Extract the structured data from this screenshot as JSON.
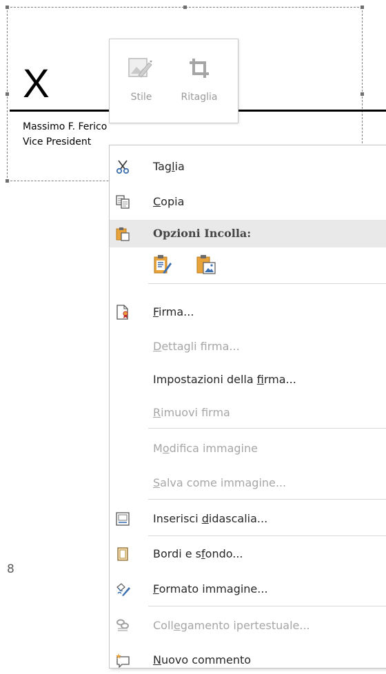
{
  "signature": {
    "mark": "X",
    "name": "Massimo F. Ferico",
    "title": "Vice President"
  },
  "mini_toolbar": {
    "style_label": "Stile",
    "crop_label": "Ritaglia"
  },
  "menu": {
    "cut": {
      "pre": "Tag",
      "key": "l",
      "post": "ia"
    },
    "copy": {
      "pre": "",
      "key": "C",
      "post": "opia"
    },
    "paste_header": "Opzioni Incolla:",
    "sign": {
      "pre": "",
      "key": "F",
      "post": "irma..."
    },
    "signature_details": {
      "pre": "",
      "key": "D",
      "post": "ettagli firma..."
    },
    "signature_setup": {
      "pre": "Impostazioni della ",
      "key": "f",
      "post": "irma..."
    },
    "remove_signature": {
      "pre": "",
      "key": "R",
      "post": "imuovi firma"
    },
    "change_picture": {
      "pre": "M",
      "key": "o",
      "post": "difica immagine"
    },
    "save_as_picture": {
      "pre": "",
      "key": "S",
      "post": "alva come immagine..."
    },
    "insert_caption": {
      "pre": "Inserisci ",
      "key": "d",
      "post": "idascalia..."
    },
    "borders_shading": {
      "pre": "Bordi e s",
      "key": "f",
      "post": "ondo..."
    },
    "format_picture": {
      "pre": "",
      "key": "F",
      "post": "ormato immagine..."
    },
    "hyperlink": {
      "pre": "Coll",
      "key": "e",
      "post": "gamento ipertestuale..."
    },
    "new_comment": {
      "pre": "",
      "key": "N",
      "post": "uovo commento"
    }
  },
  "page_number": "8",
  "colors": {
    "accent_orange": "#e8a33a",
    "icon_blue": "#3c6fb0",
    "disabled_text": "#a6a6a6",
    "header_bg": "#e9e9e9"
  }
}
